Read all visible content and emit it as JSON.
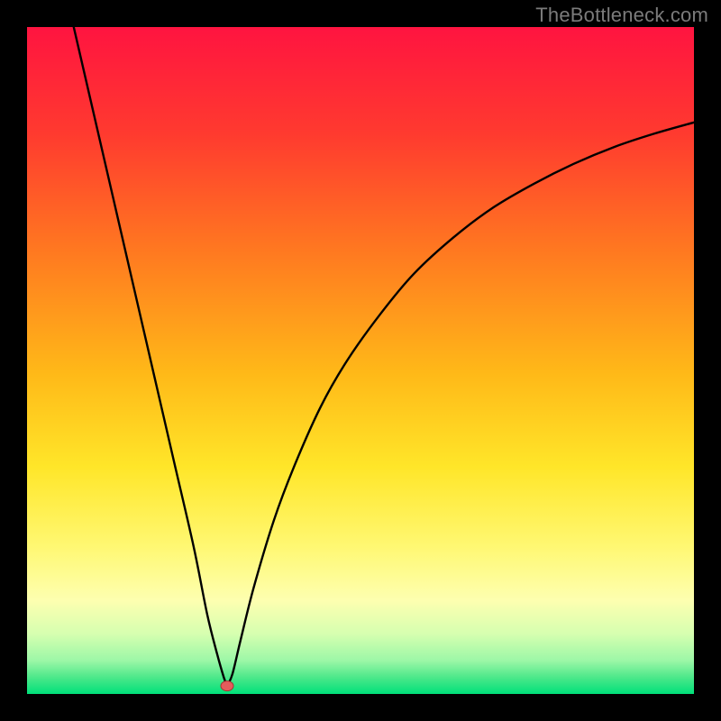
{
  "watermark": "TheBottleneck.com",
  "colors": {
    "frame": "#000000",
    "curve": "#000000",
    "marker_fill": "#e55c5c",
    "marker_stroke": "#a83232",
    "gradient_stops": [
      {
        "offset": 0.0,
        "color": "#ff1440"
      },
      {
        "offset": 0.16,
        "color": "#ff3a2f"
      },
      {
        "offset": 0.34,
        "color": "#ff7a20"
      },
      {
        "offset": 0.52,
        "color": "#ffb918"
      },
      {
        "offset": 0.66,
        "color": "#ffe629"
      },
      {
        "offset": 0.78,
        "color": "#fff873"
      },
      {
        "offset": 0.86,
        "color": "#fdffb0"
      },
      {
        "offset": 0.91,
        "color": "#d6ffb0"
      },
      {
        "offset": 0.95,
        "color": "#9cf7a7"
      },
      {
        "offset": 0.975,
        "color": "#4de88a"
      },
      {
        "offset": 1.0,
        "color": "#00e07a"
      }
    ]
  },
  "chart_data": {
    "type": "line",
    "title": "",
    "xlabel": "",
    "ylabel": "",
    "xlim": [
      0,
      100
    ],
    "ylim": [
      0,
      100
    ],
    "grid": false,
    "legend": false,
    "marker": {
      "x": 30,
      "y": 1.2,
      "r": 1.1
    },
    "series": [
      {
        "name": "left-branch",
        "x": [
          7,
          10,
          13,
          16,
          19,
          22,
          25,
          27,
          28.5,
          29.5,
          30
        ],
        "y": [
          100,
          87,
          74,
          61,
          48,
          35,
          22,
          12,
          6,
          2.5,
          1.2
        ]
      },
      {
        "name": "right-branch",
        "x": [
          30,
          30.8,
          32,
          34,
          37,
          40,
          44,
          48,
          53,
          58,
          64,
          70,
          76,
          82,
          88,
          94,
          100
        ],
        "y": [
          1.2,
          3,
          8,
          16,
          26,
          34,
          43,
          50,
          57,
          63,
          68.5,
          73,
          76.5,
          79.5,
          82,
          84,
          85.7
        ]
      }
    ]
  }
}
